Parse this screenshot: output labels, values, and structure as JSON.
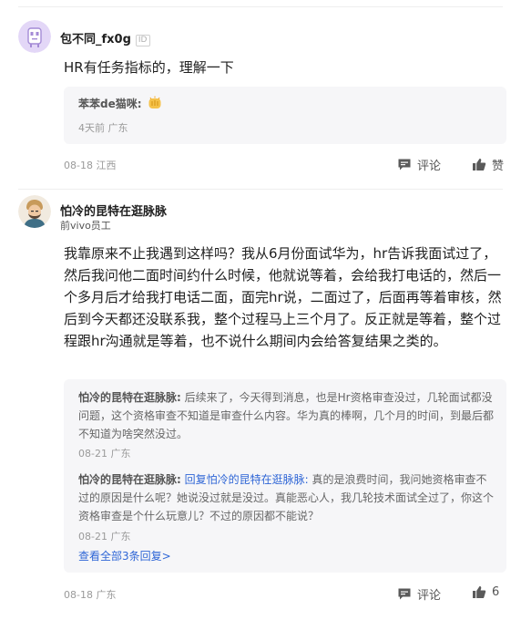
{
  "comments": [
    {
      "user": "包不同_fx0g",
      "id_badge": "ID",
      "text": "HR有任务指标的，理解一下",
      "replies": [
        {
          "author": "苯苯de猫咪:",
          "text": "",
          "emoji": "clapping-hands",
          "meta": "4天前 广东"
        }
      ],
      "meta": "08-18 江西",
      "comment_label": "评论",
      "like_label": "赞"
    },
    {
      "user": "怕冷的昆特在逛脉脉",
      "subtitle": "前vivo员工",
      "text": "我靠原来不止我遇到这样吗？我从6月份面试华为，hr告诉我面试过了，然后我问他二面时间约什么时候，他就说等着，会给我打电话的，然后一个多月后才给我打电话二面，面完hr说，二面过了，后面再等着审核，然后到今天都还没联系我，整个过程马上三个月了。反正就是等着，整个过程跟hr沟通就是等着，也不说什么期间内会给答复结果之类的。",
      "replies": [
        {
          "author": "怕冷的昆特在逛脉脉:",
          "text": "后续来了，今天得到消息，也是Hr资格审查没过，几轮面试都没问题，这个资格审查不知道是审查什么内容。华为真的棒啊，几个月的时间，到最后都不知道为啥突然没过。",
          "meta": "08-21 广东"
        },
        {
          "author": "怕冷的昆特在逛脉脉:",
          "reply_to": "回复怕冷的昆特在逛脉脉:",
          "text": "真的是浪费时间，我问她资格审查不过的原因是什么呢？她说没过就是没过。真能恶心人，我几轮技术面试全过了，你这个资格审查是个什么玩意儿？不过的原因都不能说？",
          "meta": "08-21 广东"
        }
      ],
      "view_all": "查看全部3条回复>",
      "meta": "08-18 广东",
      "comment_label": "评论",
      "like_count": "6"
    }
  ]
}
